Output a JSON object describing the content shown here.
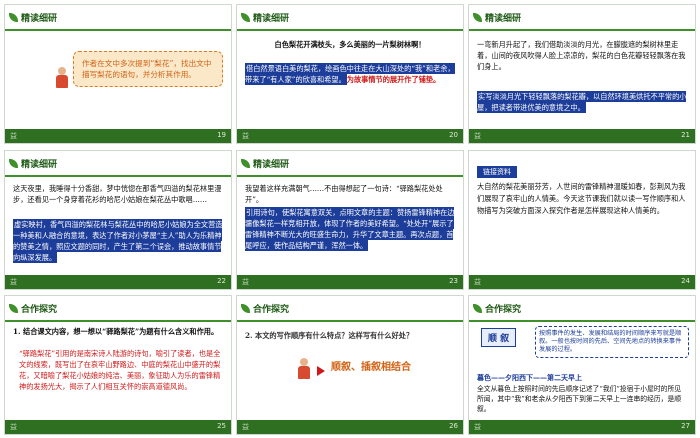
{
  "slides": [
    {
      "page": "19",
      "heading": "精读细研",
      "question": "作者在文中多次提到“梨花”，找出文中描写梨花的语句，并分析其作用。",
      "foot": "益"
    },
    {
      "page": "20",
      "heading": "精读细研",
      "line1": "白色梨花开满枝头，多么美丽的一片梨树林啊！",
      "ans": "借白然景语白美的梨花，绘画色中往走在大山深处的“我”和老余，带来了“有人家”的欣喜和希望。",
      "ans2": "为故事情节的展开作了铺垫。",
      "foot": "益"
    },
    {
      "page": "21",
      "heading": "精读细研",
      "body": "一弯新月升起了，我们借助淡淡的月光，在朦胧遮的梨树林里走着，山间的夜风吹得人脸上凉凉的，梨花的白色花瓣轻轻飘落在我们身上。",
      "ans": "实写淡淡月光下轻轻飘落的梨花瓣，以自然环境美烘托不平常的小屋，把读者带进优美的意境之中。",
      "foot": "益"
    },
    {
      "page": "22",
      "heading": "精读细研",
      "body": "这天夜里，我睡得十分香甜，梦中恍惚在那香气四溢的梨花林里漫步，还看见一个身穿着花衫的哈尼小姑娘在梨花丛中歌唱……",
      "ans": "虚实映衬，香气四溢的梨花林与梨花丛中的哈尼小姑娘为全文营造一种美和人融合的意境，表达了作者对小茅屋“主人”助人为乐精神的赞美之情，照应文题的同时，产生了第二个误会，推动故事情节向纵深发展。",
      "foot": "益"
    },
    {
      "page": "23",
      "heading": "精读细研",
      "body": "我望着这样充满朝气……不由得想起了一句诗：“驿路梨花处处开”。",
      "ans": "引用诗句，使梨花寓意双关，点明文章的主题：赞扬雷锋精神在边疆像梨花一样竞相开放，体现了作者的美好希望。“处处开”展示了雷锋精神不断光大的旺盛生命力，升华了文章主题。再次点题，首尾呼应，使作品结构严谨，浑然一体。",
      "foot": "益"
    },
    {
      "page": "24",
      "badge": "链接资料",
      "body": "大自然的梨花美丽芬芳，人世间的雷锋精神温暖如春，彭荆风为我们展现了哀牢山的人情美。今天这节课我们就以读一写作顺序和人物描写为突破方面深入探究作者是怎样展现这种人情美的。",
      "foot": "益"
    },
    {
      "page": "25",
      "heading": "合作探究",
      "q": "1. 结合课文内容，想一想以“驿路梨花”为题有什么含义和作用。",
      "ans": "“驿路梨花”引用的是南宋诗人陆游的诗句，喻引了读者，也是全文的线索，既写出了在哀牢山野路边、中庭的梨花山中盛开的梨花，又暗喻了梨花小姑娘的纯洁、美丽，象征助人为乐的雷锋精神的发扬光大，揭示了人们相互关怀的崇高道德风尚。",
      "foot": "益"
    },
    {
      "page": "26",
      "heading": "合作探究",
      "q": "2. 本文的写作顺序有什么特点？这样写有什么好处？",
      "ans": "顺叙、插叙相结合",
      "foot": "益"
    },
    {
      "page": "27",
      "heading": "合作探究",
      "badge": "顺  叙",
      "def": "按照事件的发生、发展和结局的时间顺序来写就是顺叙。一般也按时间的先后、空间先地点的转换来事件发展的过程。",
      "line": "暮色——夕阳西下——第二天早上",
      "body": "全文从暮色上按照时间的先后顺序记述了“我们”投宿于小屋时的所见所闻，其中“我”和老余从夕阳西下到第二天早上一连串的经历，是顺叙。",
      "foot": "益"
    }
  ]
}
